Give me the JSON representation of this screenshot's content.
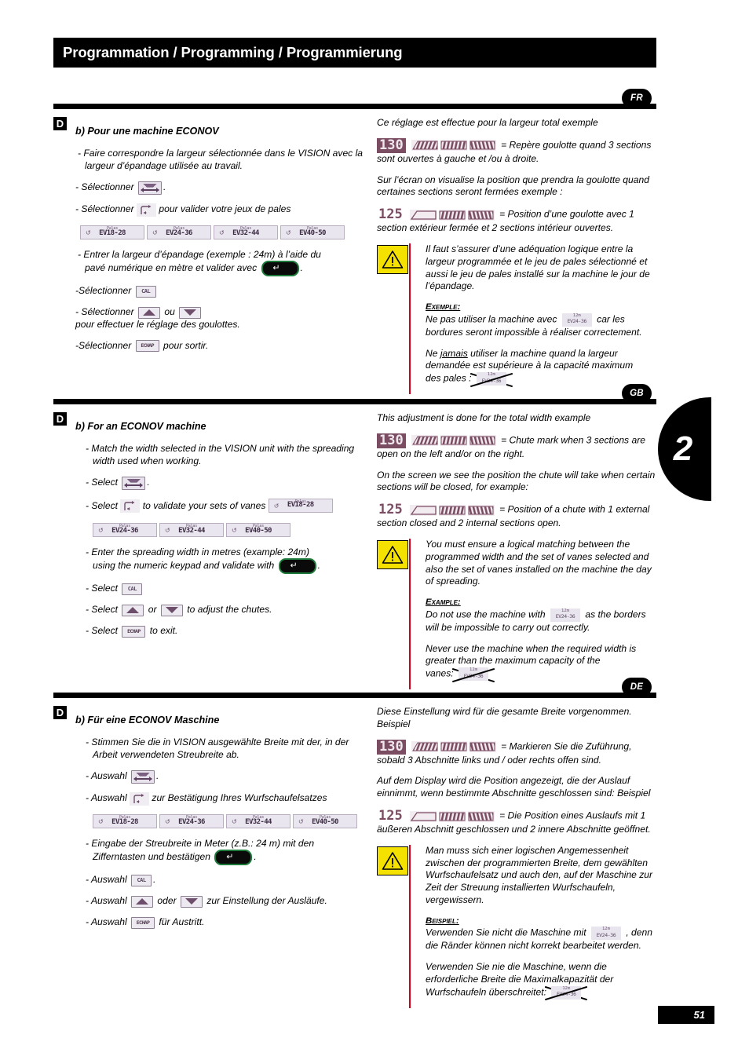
{
  "page": {
    "title": "Programmation / Programming / Programmierung",
    "chapter_tab": "2",
    "page_number": "51"
  },
  "icons": {
    "section_marker": "D",
    "cal_key": "CAL",
    "esc_key": "ECHAP",
    "enter_key": "↵",
    "vane_chip_top": "Palas",
    "vane_small_top": "12m",
    "vane_small_name": "EV24-36"
  },
  "vanes": [
    {
      "top": "Palas",
      "name": "EV18-28"
    },
    {
      "top": "Palas",
      "name": "EV24-36"
    },
    {
      "top": "Palas",
      "name": "EV32-44"
    },
    {
      "top": "Palas",
      "name": "EV40-50"
    }
  ],
  "lcd": {
    "total": {
      "value": "130",
      "inverted": true,
      "sections": [
        "hatch",
        "hatch",
        "hatch"
      ]
    },
    "partial": {
      "value": "125",
      "inverted": false,
      "sections": [
        "open",
        "hatch",
        "hatch"
      ]
    }
  },
  "fr": {
    "badge": "FR",
    "marker": "D",
    "heading": "b) Pour une machine ECONOV",
    "step1": "- Faire correspondre la largeur sélectionnée dans le VISION avec la largeur d’épandage utilisée au travail.",
    "step2_pre": "- Sélectionner",
    "step2_post": ".",
    "step3_pre": "- Sélectionner",
    "step3_post": "pour valider votre jeux de pales",
    "step4_a": "- Entrer la largeur d’épandage (exemple : 24m) à l’aide du",
    "step4_b": "pavé numérique en mètre et valider avec",
    "step4_end": ".",
    "step5_pre": "-Sélectionner",
    "step6_pre": "- Sélectionner",
    "step6_mid": "ou",
    "step6_post": "pour effectuer le réglage des goulottes.",
    "step7_pre": "-Sélectionner",
    "step7_post": "pour sortir.",
    "right_intro": "Ce réglage est effectue pour la largeur total exemple",
    "right_lcd1_desc": "= Repère goulotte quand 3 sections sont ouvertes à gauche et /ou à droite.",
    "right_para2": "Sur l’écran on visualise la position que prendra la goulotte quand certaines sections seront fermées exemple :",
    "right_lcd2_desc": "= Position d’une goulotte avec 1 section extérieur fermée et 2 sections intérieur ouvertes.",
    "warn_main": "Il faut s’assurer d’une adéquation logique entre la largeur programmée et le jeu de pales sélectionné et aussi le jeu de pales installé sur la machine le jour de l’épandage.",
    "example_label": "Exemple:",
    "warn_ex_pre": "Ne pas utiliser la machine avec",
    "warn_ex_post": "car les bordures seront impossible à réaliser correctement.",
    "warn_never_a": "Ne",
    "warn_never_u": "jamais",
    "warn_never_b": "utiliser la machine quand la largeur demandée est supérieure à la capacité maximum",
    "warn_never_c": "des pales :"
  },
  "gb": {
    "badge": "GB",
    "marker": "D",
    "heading": "b) For an ECONOV machine",
    "step1": "- Match the width selected in the VISION unit with the spreading width used when working.",
    "step2_pre": "- Select",
    "step2_post": ".",
    "step3_pre": "- Select",
    "step3_post": "to validate your sets of vanes",
    "step4_a": "- Enter the spreading width in metres (example: 24m)",
    "step4_b": "using the numeric keypad and validate with",
    "step4_end": ".",
    "step5_pre": "- Select",
    "step6_pre": "- Select",
    "step6_mid": "or",
    "step6_post": "to adjust the chutes.",
    "step7_pre": "- Select",
    "step7_post": "to exit.",
    "right_intro": "This adjustment is done for the total width example",
    "right_lcd1_desc": "= Chute mark when 3 sections are open on the left and/or on the right.",
    "right_para2": "On the screen we see the position the chute will take when certain sections will be closed, for example:",
    "right_lcd2_desc": "= Position of a chute with 1 external section closed and 2 internal sections open.",
    "warn_main": "You must ensure a logical matching between the programmed width and the set of vanes selected and also the set of vanes installed on the machine the day of spreading.",
    "example_label": "Example:",
    "warn_ex_pre": "Do not use the machine with",
    "warn_ex_post": "as the borders will be impossible to carry out correctly.",
    "warn_never_b": "Never use the machine when the required width is greater than the maximum capacity of the",
    "warn_never_c": "vanes:"
  },
  "de": {
    "badge": "DE",
    "marker": "D",
    "heading": "b) Für eine ECONOV Maschine",
    "step1": "- Stimmen Sie die in VISION ausgewählte Breite mit der, in der Arbeit verwendeten Streubreite ab.",
    "step2_pre": "- Auswahl",
    "step2_post": ".",
    "step3_pre": "- Auswahl",
    "step3_post": "zur Bestätigung Ihres Wurfschaufelsatzes",
    "step4_a": "- Eingabe der Streubreite in Meter (z.B.: 24 m) mit den",
    "step4_b": "Zifferntasten und bestätigen",
    "step4_end": ".",
    "step5_pre": "- Auswahl",
    "step6_pre": "- Auswahl",
    "step6_mid": "oder",
    "step6_post": "zur Einstellung der Ausläufe.",
    "step7_pre": "- Auswahl",
    "step7_post": "für Austritt.",
    "right_intro": "Diese Einstellung wird für die gesamte Breite vorgenommen. Beispiel",
    "right_lcd1_desc": "= Markieren Sie die Zuführung, sobald 3 Abschnitte links und / oder rechts offen sind.",
    "right_para2": "Auf dem Display wird die Position angezeigt, die der Auslauf einnimmt, wenn bestimmte Abschnitte geschlossen sind: Beispiel",
    "right_lcd2_desc": "= Die Position eines Auslaufs mit 1 äußeren Abschnitt geschlossen und 2 innere Abschnitte geöffnet.",
    "warn_main": "Man muss sich einer logischen Angemessenheit zwischen der programmierten Breite, dem gewählten Wurfschaufelsatz und auch den, auf der Maschine zur Zeit der Streuung installierten Wurfschaufeln, vergewissern.",
    "example_label": "Beispiel:",
    "warn_ex_pre": "Verwenden Sie nicht die Maschine mit",
    "warn_ex_post": ", denn die Ränder können nicht korrekt bearbeitet werden.",
    "warn_never_b": "Verwenden Sie nie die Maschine, wenn die erforderliche Breite die Maximalkapazität der Wurfschaufeln überschreitet:"
  },
  "colors": {
    "warning_yellow": "#f5e100",
    "warning_red_bar": "#d0021b",
    "lcd_purple": "#7b4d63",
    "key_fill": "#ece9f0",
    "enter_green": "#1d7a3a"
  }
}
